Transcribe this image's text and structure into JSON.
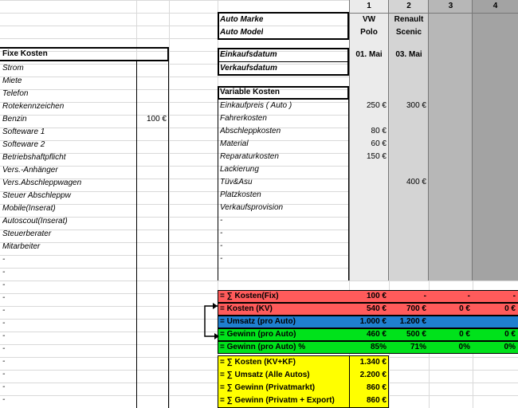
{
  "colors": {
    "fix_row": "#ff5b5b",
    "kv_row": "#ff5b5b",
    "umsatz_row": "#1f7fd0",
    "gewinn_row": "#00e21b",
    "totals_block": "#ffff00",
    "col1_fill": "#ebebeb",
    "col2_fill": "#d4d4d4",
    "col3_fill": "#b7b7b7",
    "col4_fill": "#a3a3a3"
  },
  "fixed_costs": {
    "header": "Fixe Kosten",
    "items": [
      {
        "label": "Strom",
        "value": ""
      },
      {
        "label": "Miete",
        "value": ""
      },
      {
        "label": "Telefon",
        "value": ""
      },
      {
        "label": "Rotekennzeichen",
        "value": ""
      },
      {
        "label": "Benzin",
        "value": "100 €"
      },
      {
        "label": "Softeware 1",
        "value": ""
      },
      {
        "label": "Softeware 2",
        "value": ""
      },
      {
        "label": "Betriebshaftpflicht",
        "value": ""
      },
      {
        "label": "Vers.-Anhänger",
        "value": ""
      },
      {
        "label": "Vers.Abschleppwagen",
        "value": ""
      },
      {
        "label": "Steuer Abschleppw",
        "value": ""
      },
      {
        "label": "Mobile(Inserat)",
        "value": ""
      },
      {
        "label": "Autoscout(Inserat)",
        "value": ""
      },
      {
        "label": "Steuerberater",
        "value": ""
      },
      {
        "label": "Mitarbeiter",
        "value": ""
      },
      {
        "label": "-",
        "value": ""
      },
      {
        "label": "-",
        "value": ""
      },
      {
        "label": "-",
        "value": ""
      },
      {
        "label": "-",
        "value": ""
      },
      {
        "label": "-",
        "value": ""
      },
      {
        "label": "-",
        "value": ""
      },
      {
        "label": "-",
        "value": ""
      },
      {
        "label": "-",
        "value": ""
      },
      {
        "label": "-",
        "value": ""
      },
      {
        "label": "-",
        "value": ""
      },
      {
        "label": "-",
        "value": ""
      },
      {
        "label": "-",
        "value": ""
      }
    ]
  },
  "columns": {
    "numbers": [
      "1",
      "2",
      "3",
      "4"
    ]
  },
  "car_header": {
    "marke_label": "Auto Marke",
    "model_label": "Auto Model",
    "car1_make": "VW",
    "car1_model": "Polo",
    "car2_make": "Renault",
    "car2_model": "Scenic"
  },
  "dates": {
    "einkauf_label": "Einkaufsdatum",
    "verkauf_label": "Verkaufsdatum",
    "car1_einkauf": "01. Mai",
    "car2_einkauf": "03. Mai"
  },
  "variable_costs": {
    "header": "Variable Kosten",
    "items": [
      {
        "label": "Einkaufpreis ( Auto )",
        "c1": "250 €",
        "c2": "300 €"
      },
      {
        "label": "Fahrerkosten",
        "c1": "",
        "c2": ""
      },
      {
        "label": "Abschleppkosten",
        "c1": "80 €",
        "c2": ""
      },
      {
        "label": "Material",
        "c1": "60 €",
        "c2": ""
      },
      {
        "label": "Reparaturkosten",
        "c1": "150 €",
        "c2": ""
      },
      {
        "label": "Lackierung",
        "c1": "",
        "c2": ""
      },
      {
        "label": "Tüv&Asu",
        "c1": "",
        "c2": "400 €"
      },
      {
        "label": "Platzkosten",
        "c1": "",
        "c2": ""
      },
      {
        "label": "Verkaufsprovision",
        "c1": "",
        "c2": ""
      },
      {
        "label": "-",
        "c1": "",
        "c2": ""
      },
      {
        "label": "-",
        "c1": "",
        "c2": ""
      },
      {
        "label": "-",
        "c1": "",
        "c2": ""
      },
      {
        "label": "-",
        "c1": "",
        "c2": ""
      }
    ]
  },
  "summary": {
    "kosten_fix": {
      "label": "= ∑ Kosten(Fix)",
      "values": [
        "100 €",
        "-",
        "-",
        "-"
      ]
    },
    "kosten_kv": {
      "label": "= Kosten (KV)",
      "values": [
        "540 €",
        "700 €",
        "0 €",
        "0 €"
      ]
    },
    "umsatz": {
      "label": "= Umsatz (pro Auto)",
      "values": [
        "1.000 €",
        "1.200 €",
        "",
        ""
      ]
    },
    "gewinn": {
      "label": "= Gewinn (pro Auto)",
      "values": [
        "460 €",
        "500 €",
        "0 €",
        "0 €"
      ]
    },
    "gewinn_pct": {
      "label": "= Gewinn (pro Auto) %",
      "values": [
        "85%",
        "71%",
        "0%",
        "0%"
      ]
    }
  },
  "totals": [
    {
      "label": "= ∑ Kosten (KV+KF)",
      "value": "1.340 €"
    },
    {
      "label": "= ∑ Umsatz (Alle Autos)",
      "value": "2.200 €"
    },
    {
      "label": "= ∑ Gewinn (Privatmarkt)",
      "value": "860 €"
    },
    {
      "label": "= ∑ Gewinn (Privatm + Export)",
      "value": "860 €"
    }
  ]
}
